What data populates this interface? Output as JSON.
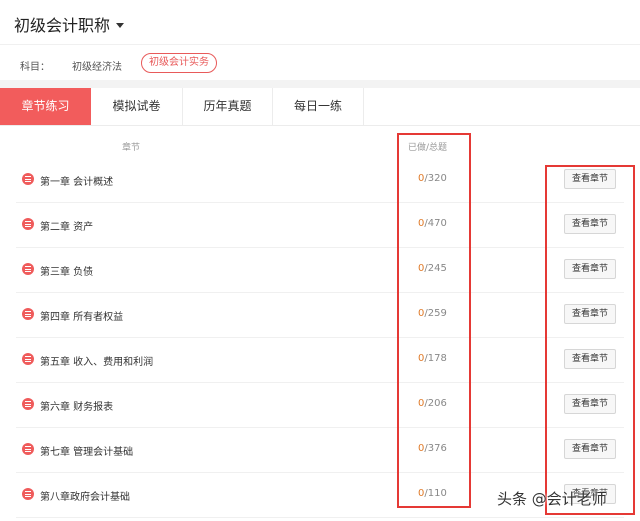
{
  "header": {
    "title": "初级会计职称"
  },
  "subject": {
    "label": "科目：",
    "options": [
      "初级经济法",
      "初级会计实务"
    ],
    "selected": "初级会计实务"
  },
  "tabs": [
    "章节练习",
    "模拟试卷",
    "历年真题",
    "每日一练"
  ],
  "active_tab": "章节练习",
  "columns": {
    "chapter": "章节",
    "progress": "已做/总题"
  },
  "chapters": [
    {
      "name": "第一章 会计概述",
      "done": "0",
      "total": "/320",
      "action": "查看章节"
    },
    {
      "name": "第二章 资产",
      "done": "0",
      "total": "/470",
      "action": "查看章节"
    },
    {
      "name": "第三章 负债",
      "done": "0",
      "total": "/245",
      "action": "查看章节"
    },
    {
      "name": "第四章 所有者权益",
      "done": "0",
      "total": "/259",
      "action": "查看章节"
    },
    {
      "name": "第五章 收入、费用和利润",
      "done": "0",
      "total": "/178",
      "action": "查看章节"
    },
    {
      "name": "第六章 财务报表",
      "done": "0",
      "total": "/206",
      "action": "查看章节"
    },
    {
      "name": "第七章 管理会计基础",
      "done": "0",
      "total": "/376",
      "action": "查看章节"
    },
    {
      "name": "第八章政府会计基础",
      "done": "0",
      "total": "/110",
      "action": "查看章节"
    }
  ],
  "watermark": "头条 @会计老师",
  "colors": {
    "accent": "#f25c5c",
    "done": "#e07b2a",
    "highlight": "#e53935"
  }
}
